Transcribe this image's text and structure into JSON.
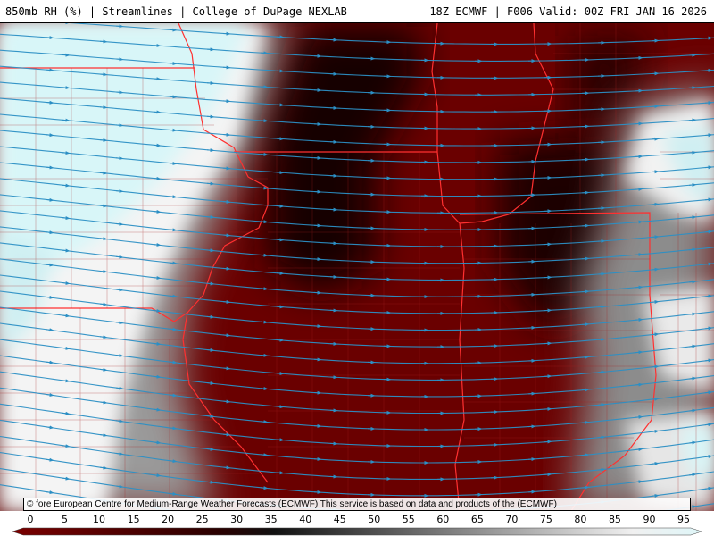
{
  "header": {
    "title_left": "850mb RH (%) | Streamlines | College of DuPage NEXLAB",
    "title_right": "18Z ECMWF | F006 Valid: 00Z FRI JAN 16 2026"
  },
  "credit": "© fore European Centre for Medium-Range Weather Forecasts (ECMWF) This service is based on data and products of the (ECMWF)",
  "colorbar": {
    "ticks": [
      "0",
      "5",
      "10",
      "15",
      "20",
      "25",
      "30",
      "35",
      "40",
      "45",
      "50",
      "55",
      "60",
      "65",
      "70",
      "75",
      "80",
      "85",
      "90",
      "95"
    ]
  },
  "colors": {
    "dry": "#6a0000",
    "dark": "#120000",
    "moist": "#d8f6f8",
    "streamline": "#2c8fc4",
    "border": "#ff3030"
  }
}
